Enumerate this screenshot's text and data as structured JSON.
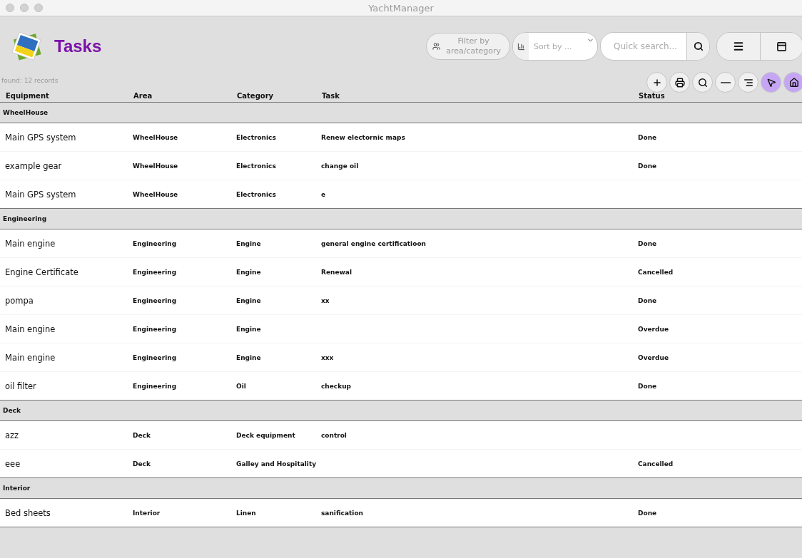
{
  "window": {
    "title": "YachtManager"
  },
  "header": {
    "title": "Tasks",
    "filter_button": {
      "line1": "Filter by",
      "line2": "area/category"
    },
    "sort": {
      "placeholder": "Sort by ..."
    },
    "search": {
      "placeholder": "Quick search..."
    }
  },
  "record_count": "found: 12 records",
  "toolbar": [
    {
      "highlighted": false
    },
    {
      "highlighted": false
    },
    {
      "highlighted": false
    },
    {
      "highlighted": false
    },
    {
      "highlighted": false
    },
    {
      "highlighted": true
    },
    {
      "highlighted": true
    }
  ],
  "table": {
    "columns": [
      "Equipment",
      "Area",
      "Category",
      "Task",
      "Status"
    ],
    "groups": [
      {
        "name": "WheelHouse",
        "rows": [
          [
            "Main GPS system",
            "WheelHouse",
            "Electronics",
            "Renew electornic maps",
            "Done"
          ],
          [
            "example gear",
            "WheelHouse",
            "Electronics",
            "change oil",
            "Done"
          ],
          [
            "Main GPS system",
            "WheelHouse",
            "Electronics",
            "e",
            ""
          ]
        ]
      },
      {
        "name": "Engineering",
        "rows": [
          [
            "Main engine",
            "Engineering",
            "Engine",
            "general engine certificatioon",
            "Done"
          ],
          [
            "Engine Certificate",
            "Engineering",
            "Engine",
            "Renewal",
            "Cancelled"
          ],
          [
            "pompa",
            "Engineering",
            "Engine",
            "xx",
            "Done"
          ],
          [
            "Main engine",
            "Engineering",
            "Engine",
            "",
            "Overdue"
          ],
          [
            "Main engine",
            "Engineering",
            "Engine",
            "xxx",
            "Overdue"
          ],
          [
            "oil filter",
            "Engineering",
            "Oil",
            "checkup",
            "Done"
          ]
        ]
      },
      {
        "name": "Deck",
        "rows": [
          [
            "azz",
            "Deck",
            "Deck equipment",
            "control",
            ""
          ],
          [
            "eee",
            "Deck",
            "Galley and Hospitality",
            "",
            "Cancelled"
          ]
        ]
      },
      {
        "name": "Interior",
        "rows": [
          [
            "Bed sheets",
            "Interior",
            "Linen",
            "sanification",
            "Done"
          ]
        ]
      }
    ]
  }
}
